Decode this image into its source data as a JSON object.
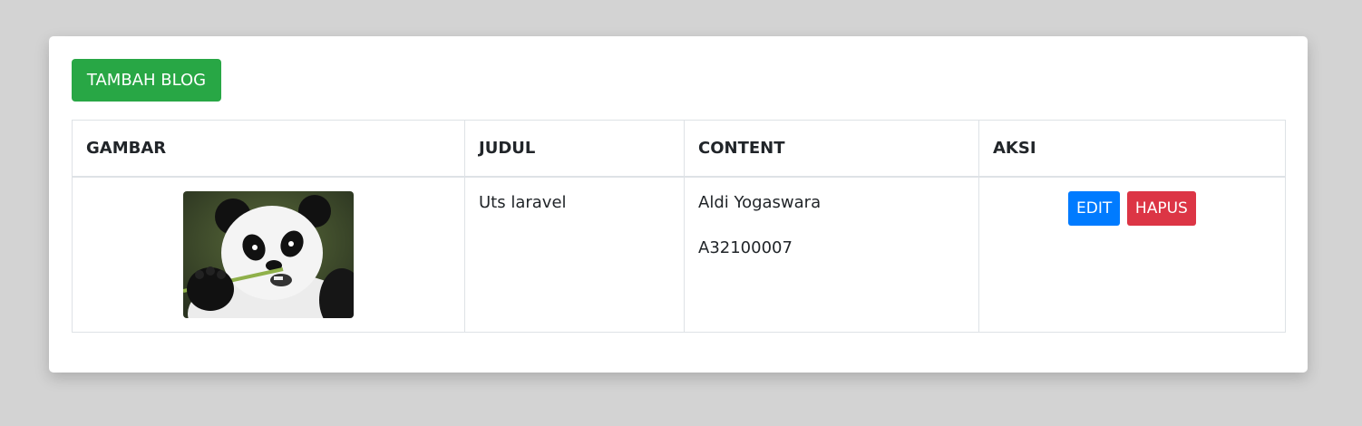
{
  "page": {
    "add_button_label": "TAMBAH BLOG"
  },
  "table": {
    "headers": [
      "GAMBAR",
      "JUDUL",
      "CONTENT",
      "AKSI"
    ],
    "rows": [
      {
        "image_icon": "panda-photo",
        "judul": "Uts laravel",
        "content_lines": [
          "Aldi Yogaswara",
          "A32100007"
        ],
        "edit_label": "EDIT",
        "hapus_label": "HAPUS"
      }
    ]
  },
  "colors": {
    "success": "#28a745",
    "primary": "#007bff",
    "danger": "#dc3545"
  }
}
